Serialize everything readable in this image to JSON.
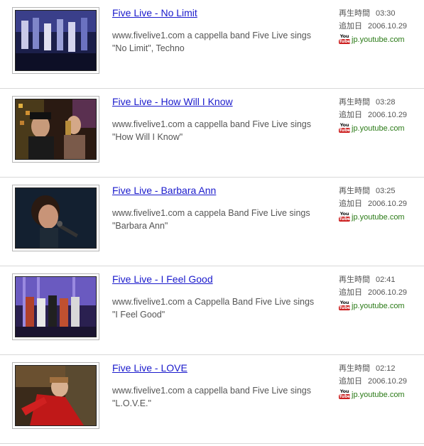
{
  "results": [
    {
      "title": "Five Live - No Limit",
      "desc_line1": "www.fivelive1.com a cappella band Five Live sings",
      "desc_line2": "\"No Limit\", Techno",
      "duration_label": "再生時間",
      "duration": "03:30",
      "added_label": "追加日",
      "added": "2006.10.29",
      "source": "jp.youtube.com"
    },
    {
      "title": "Five Live - How Will I Know",
      "desc_line1": "www.fivelive1.com a cappella band Five Live sings",
      "desc_line2": "\"How Will I Know\"",
      "duration_label": "再生時間",
      "duration": "03:28",
      "added_label": "追加日",
      "added": "2006.10.29",
      "source": "jp.youtube.com"
    },
    {
      "title": "Five Live - Barbara Ann",
      "desc_line1": "www.fivelive1.com a cappela Band Five Live sings",
      "desc_line2": "\"Barbara Ann\"",
      "duration_label": "再生時間",
      "duration": "03:25",
      "added_label": "追加日",
      "added": "2006.10.29",
      "source": "jp.youtube.com"
    },
    {
      "title": "Five Live - I Feel Good",
      "desc_line1": "www.fivelive1.com a Cappella Band Five Live sings",
      "desc_line2": "\"I Feel Good\"",
      "duration_label": "再生時間",
      "duration": "02:41",
      "added_label": "追加日",
      "added": "2006.10.29",
      "source": "jp.youtube.com"
    },
    {
      "title": "Five Live - LOVE",
      "desc_line1": "www.fivelive1.com a cappella band Five Live sings",
      "desc_line2": "\"L.O.V.E.\"",
      "duration_label": "再生時間",
      "duration": "02:12",
      "added_label": "追加日",
      "added": "2006.10.29",
      "source": "jp.youtube.com"
    }
  ],
  "logo": {
    "you": "You",
    "tube": "Tube"
  },
  "colors": {
    "link": "#1a1acc",
    "source": "#2a7a16",
    "logo_red": "#cc1f1f"
  }
}
